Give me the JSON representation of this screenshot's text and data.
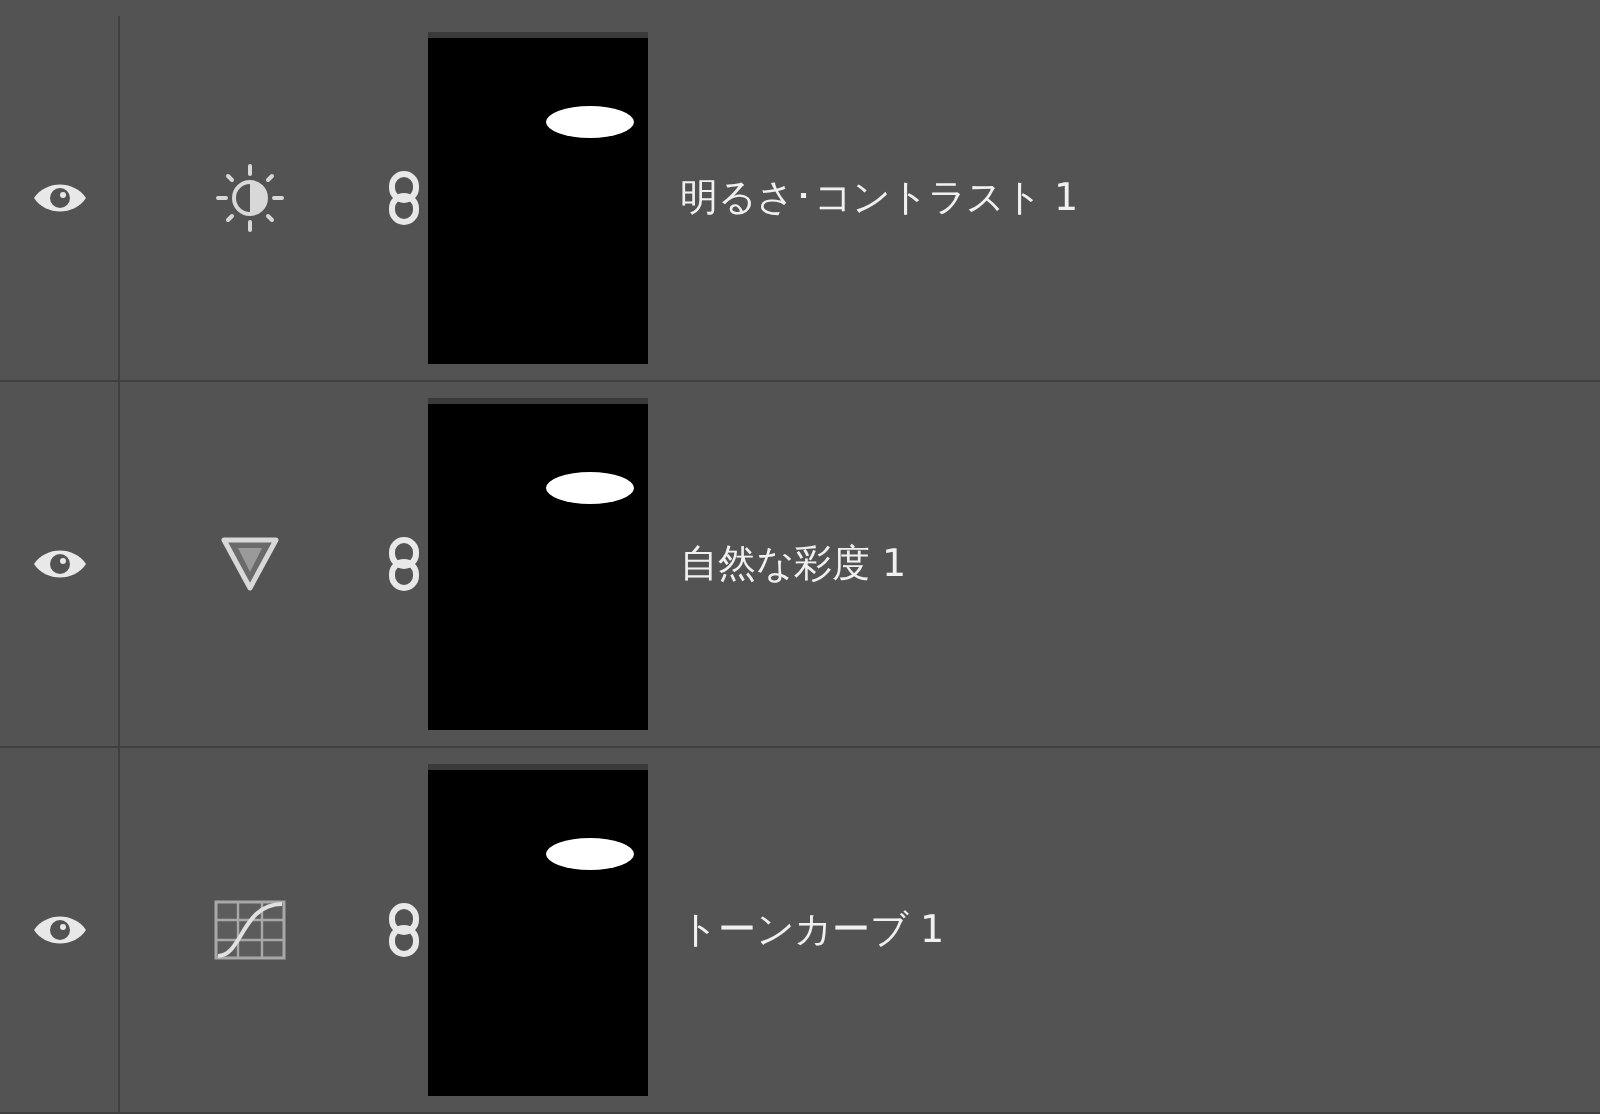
{
  "layers": [
    {
      "name": "明るさ･コントラスト 1",
      "kind": "brightness",
      "visible": true
    },
    {
      "name": "自然な彩度 1",
      "kind": "vibrance",
      "visible": true
    },
    {
      "name": "トーンカーブ 1",
      "kind": "curves",
      "visible": true
    }
  ]
}
